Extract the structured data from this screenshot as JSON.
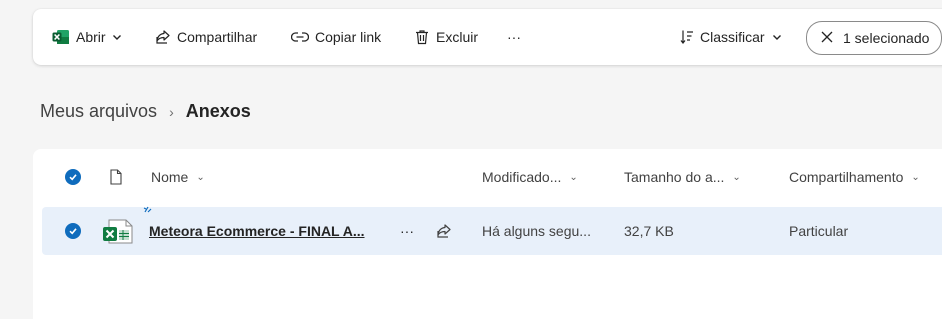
{
  "toolbar": {
    "open_label": "Abrir",
    "share_label": "Compartilhar",
    "copy_link_label": "Copiar link",
    "delete_label": "Excluir",
    "more_label": "···",
    "sort_label": "Classificar",
    "selection_label": "1 selecionado"
  },
  "breadcrumb": {
    "parent": "Meus arquivos",
    "separator": "›",
    "current": "Anexos"
  },
  "table": {
    "headers": {
      "name": "Nome",
      "modified": "Modificado...",
      "size": "Tamanho do a...",
      "sharing": "Compartilhamento"
    },
    "rows": [
      {
        "name": "Meteora Ecommerce - FINAL A...",
        "more": "···",
        "modified": "Há alguns segu...",
        "size": "32,7 KB",
        "sharing": "Particular",
        "selected": true,
        "icon": "excel-file-icon"
      }
    ]
  },
  "colors": {
    "accent": "#0f6cbd",
    "excel_green": "#107c41",
    "selected_row": "#e8f0fa",
    "page_bg": "#f5f5f5"
  }
}
